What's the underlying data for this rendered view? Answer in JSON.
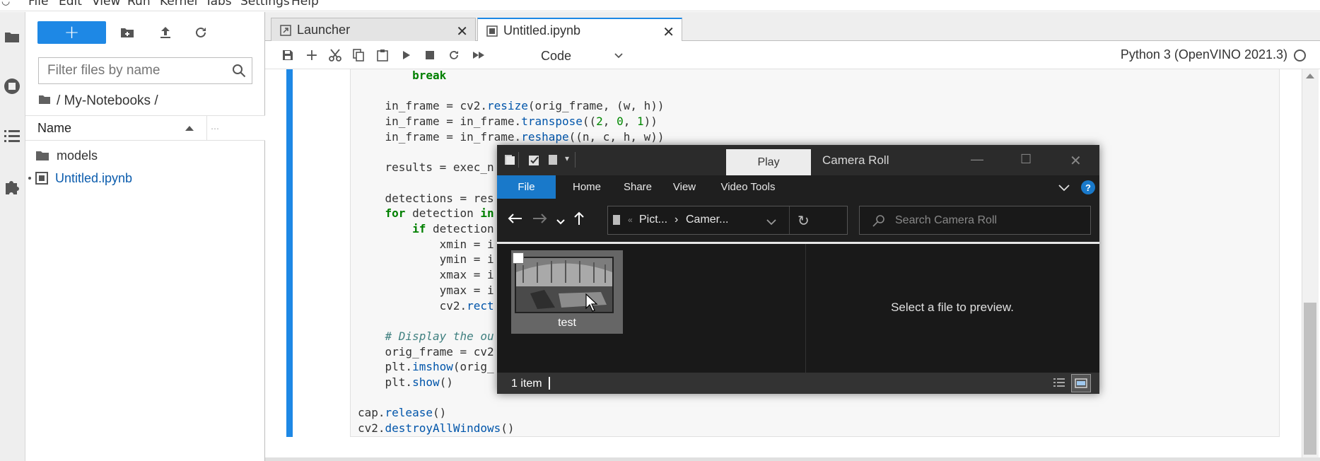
{
  "menubar": {
    "items": [
      "File",
      "Edit",
      "View",
      "Run",
      "Kernel",
      "Tabs",
      "Settings",
      "Help"
    ]
  },
  "filebrowser": {
    "new_label": "+",
    "filter_placeholder": "Filter files by name",
    "breadcrumb": "/ My-Notebooks /",
    "column_name": "Name",
    "files": [
      {
        "name": "models",
        "icon": "folder-icon"
      },
      {
        "name": "Untitled.ipynb",
        "icon": "notebook-icon"
      }
    ]
  },
  "tabs": [
    {
      "label": "Launcher",
      "icon": "launcher-icon",
      "active": false
    },
    {
      "label": "Untitled.ipynb",
      "icon": "notebook-icon",
      "active": true
    }
  ],
  "toolbar": {
    "cell_type": "Code",
    "kernel": "Python 3 (OpenVINO 2021.3)"
  },
  "code_lines": [
    "        break",
    "",
    "    in_frame = cv2.resize(orig_frame, (w, h))",
    "    in_frame = in_frame.transpose((2, 0, 1))",
    "    in_frame = in_frame.reshape((n, c, h, w))",
    "",
    "    results = exec_n",
    "",
    "    detections = res",
    "    for detection in",
    "        if detection",
    "            xmin = i",
    "            ymin = i",
    "            xmax = i",
    "            ymax = i",
    "            cv2.rect",
    "",
    "    # Display the ou",
    "    orig_frame = cv2",
    "    plt.imshow(orig_",
    "    plt.show()",
    "",
    "cap.release()",
    "cv2.destroyAllWindows()"
  ],
  "explorer": {
    "play_tab": "Play",
    "title": "Camera Roll",
    "ribbon_tabs": [
      "File",
      "Home",
      "Share",
      "View",
      "Video Tools"
    ],
    "address_parts": [
      "Pict...",
      "Camer..."
    ],
    "search_placeholder": "Search Camera Roll",
    "file_name": "test",
    "preview_text": "Select a file to preview.",
    "status": "1 item",
    "accent": "#1979ca"
  }
}
